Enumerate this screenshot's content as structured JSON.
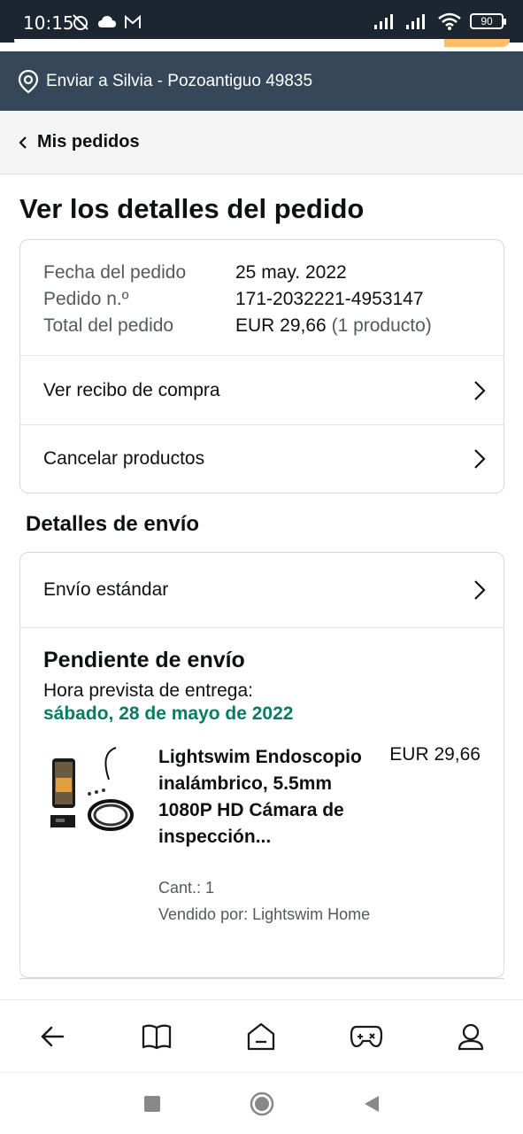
{
  "status_bar": {
    "time": "10:15",
    "battery": "90"
  },
  "deliver": {
    "text": "Enviar a Silvia - Pozoantiguo 49835",
    "icon": "location-pin-icon"
  },
  "breadcrumb": {
    "label": "Mis pedidos"
  },
  "page": {
    "title": "Ver los detalles del pedido"
  },
  "order": {
    "date_label": "Fecha del pedido",
    "date_value": "25 may. 2022",
    "number_label": "Pedido n.º",
    "number_value": "171-2032221-4953147",
    "total_label": "Total del pedido",
    "total_value": "EUR 29,66",
    "total_count": "(1 producto)",
    "receipt_link": "Ver recibo de compra",
    "cancel_link": "Cancelar productos"
  },
  "shipping": {
    "section_title": "Detalles de envío",
    "method": "Envío estándar",
    "status": "Pendiente de envío",
    "eta_label": "Hora prevista de entrega:",
    "eta_date": "sábado, 28 de mayo de 2022",
    "eta_color": "#067d62"
  },
  "product": {
    "title": "Lightswim Endoscopio inalámbrico, 5.5mm 1080P HD Cámara de inspección...",
    "price": "EUR 29,66",
    "qty": "Cant.: 1",
    "seller": "Vendido por: Lightswim Home"
  },
  "bottom_nav": [
    "back-icon",
    "book-icon",
    "home-icon",
    "gamepad-icon",
    "profile-icon"
  ],
  "colors": {
    "header": "#37475a",
    "status_bar": "#1c2630",
    "accent": "#febd69"
  }
}
